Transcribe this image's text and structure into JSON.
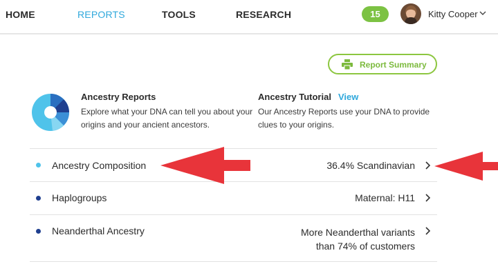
{
  "nav": {
    "items": [
      {
        "label": "HOME",
        "active": false
      },
      {
        "label": "REPORTS",
        "active": true
      },
      {
        "label": "TOOLS",
        "active": false
      },
      {
        "label": "RESEARCH",
        "active": false
      }
    ],
    "notification_count": "15",
    "user_name": "Kitty Cooper",
    "icons": [
      "avatar",
      "chevron-down-icon"
    ]
  },
  "summary_button": {
    "label": "Report Summary",
    "icon": "printer-icon"
  },
  "intro": {
    "title": "Ancestry Reports",
    "description": "Explore what your DNA can tell you about your origins and your ancient ancestors.",
    "tutorial_title": "Ancestry Tutorial",
    "tutorial_link": "View",
    "tutorial_description": "Our Ancestry Reports use your DNA to provide clues to your origins."
  },
  "reports": [
    {
      "label": "Ancestry Composition",
      "value": "36.4% Scandinavian",
      "dot_color": "#4fc3ea"
    },
    {
      "label": "Haplogroups",
      "value": "Maternal: H11",
      "dot_color": "#1f3f8f"
    },
    {
      "label": "Neanderthal Ancestry",
      "value": "More Neanderthal variants than 74% of customers",
      "dot_color": "#1f3f8f"
    }
  ],
  "colors": {
    "accent_blue": "#2fa8dc",
    "accent_green": "#7cc243",
    "annotation_red": "#e8343a"
  }
}
